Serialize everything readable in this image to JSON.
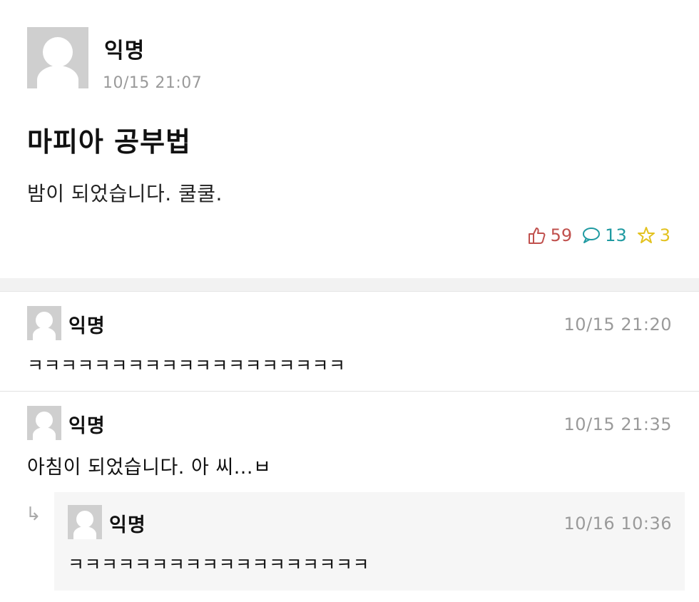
{
  "post": {
    "author": "익명",
    "timestamp": "10/15 21:07",
    "title": "마피아 공부법",
    "body": "밤이 되었습니다. 쿨쿨.",
    "stats": {
      "likes": "59",
      "comments": "13",
      "scraps": "3"
    },
    "colors": {
      "like": "#c0504d",
      "comment": "#1f9aa1",
      "scrap": "#e3c21f"
    }
  },
  "comments": [
    {
      "author": "익명",
      "timestamp": "10/15 21:20",
      "text": "ㅋㅋㅋㅋㅋㅋㅋㅋㅋㅋㅋㅋㅋㅋㅋㅋㅋㅋㅋ"
    },
    {
      "author": "익명",
      "timestamp": "10/15 21:35",
      "text": "아침이 되었습니다. 아 씨...ㅂ"
    }
  ],
  "reply": {
    "author": "익명",
    "timestamp": "10/16 10:36",
    "text": "ㅋㅋㅋㅋㅋㅋㅋㅋㅋㅋㅋㅋㅋㅋㅋㅋㅋㅋ"
  },
  "icons": {
    "like": "thumbs-up-icon",
    "comment": "speech-bubble-icon",
    "scrap": "star-icon",
    "reply": "reply-arrow-icon"
  }
}
